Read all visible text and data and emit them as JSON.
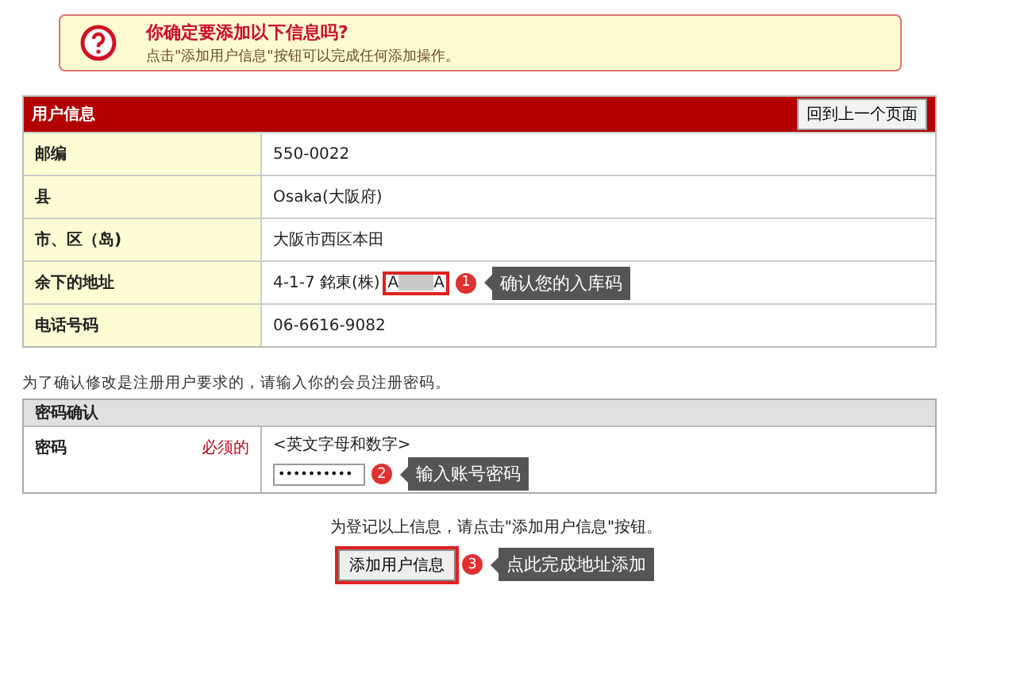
{
  "alert": {
    "title": "你确定要添加以下信息吗?",
    "message": "点击\"添加用户信息\"按钮可以完成任何添加操作。"
  },
  "user_info": {
    "title": "用户信息",
    "back_button": "回到上一个页面",
    "rows": [
      {
        "label": "邮编",
        "value": "550-0022"
      },
      {
        "label": "县",
        "value": "Osaka(大阪府)"
      },
      {
        "label": "市、区（岛)",
        "value": "大阪市西区本田"
      },
      {
        "label": "余下的地址",
        "value": "4-1-7 銘東(株)",
        "code_start": "A",
        "code_end": "A",
        "badge": "1",
        "callout": "确认您的入库码"
      },
      {
        "label": "电话号码",
        "value": "06-6616-9082"
      }
    ]
  },
  "password_note": "为了确认修改是注册用户要求的，请输入你的会员注册密码。",
  "password": {
    "title": "密码确认",
    "label": "密码",
    "required": "必须的",
    "hint": "<英文字母和数字>",
    "value": "••••••••••",
    "badge": "2",
    "callout": "输入账号密码"
  },
  "submit": {
    "note": "为登记以上信息，请点击\"添加用户信息\"按钮。",
    "button": "添加用户信息",
    "badge": "3",
    "callout": "点此完成地址添加"
  }
}
